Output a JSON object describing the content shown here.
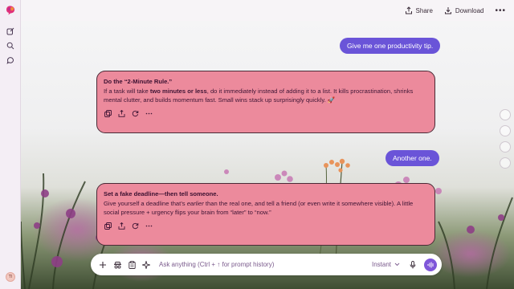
{
  "topbar": {
    "share_label": "Share",
    "download_label": "Download",
    "more_label": "•••"
  },
  "rail": {
    "avatar_initials": "TI"
  },
  "messages": [
    {
      "role": "user",
      "text": "Give me one productivity tip."
    },
    {
      "role": "assistant",
      "title": "Do the “2-Minute Rule.”",
      "body_a": "If a task will take ",
      "body_b": "two minutes or less",
      "body_c": ", do it immediately instead of adding it to a list. It kills procrastination, shrinks mental clutter, and builds momentum fast. Small wins stack up surprisingly quickly. ",
      "emoji": "🚀"
    },
    {
      "role": "user",
      "text": "Another one."
    },
    {
      "role": "assistant",
      "title": "Set a fake deadline—then tell someone.",
      "body_a": "Give yourself a deadline that’s ",
      "body_b": "earlier",
      "body_c": " than the real one, and tell a friend (or even write it somewhere visible). A little social pressure + urgency flips your brain from “later” to “now.”"
    }
  ],
  "composer": {
    "placeholder": "Ask anything (Ctrl + ↑ for prompt history)",
    "mode_label": "Instant"
  },
  "colors": {
    "user_bubble": "#6a54d8",
    "ai_bubble": "#ec8a9c",
    "accent": "#7f56d9"
  }
}
